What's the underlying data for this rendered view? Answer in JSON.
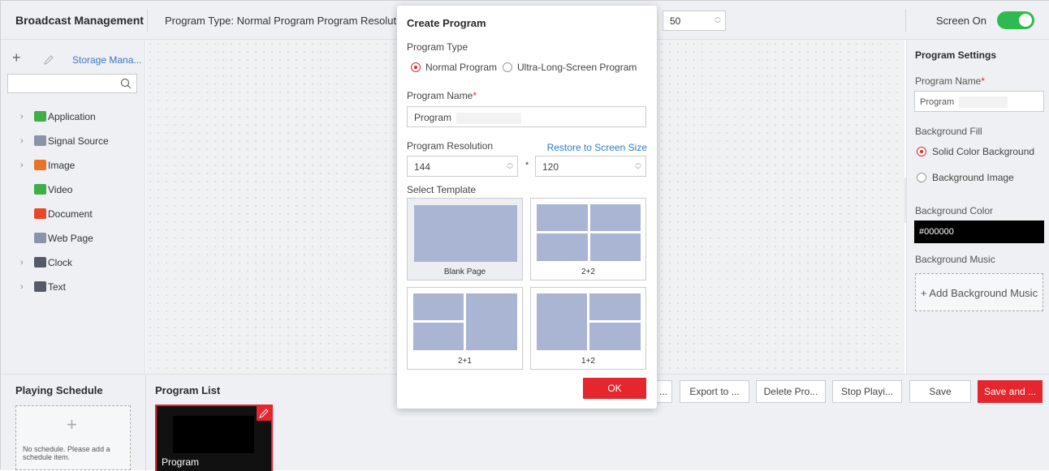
{
  "topbar": {
    "title": "Broadcast Management",
    "info": "Program Type: Normal Program   Program Resolution",
    "zoom_value": "50",
    "screen_label": "Screen On",
    "screen_on": true
  },
  "sidebar": {
    "storage_label": "Storage Mana...",
    "search_value": "",
    "items": [
      {
        "label": "Application",
        "icon": "application-icon",
        "expandable": true,
        "color": "#3fae49"
      },
      {
        "label": "Signal Source",
        "icon": "signal-source-icon",
        "expandable": true,
        "color": "#8a94a6"
      },
      {
        "label": "Image",
        "icon": "image-icon",
        "expandable": true,
        "color": "#e8742a"
      },
      {
        "label": "Video",
        "icon": "video-icon",
        "expandable": false,
        "color": "#3fae49"
      },
      {
        "label": "Document",
        "icon": "pdf-icon",
        "expandable": false,
        "color": "#e8472a"
      },
      {
        "label": "Web Page",
        "icon": "web-page-icon",
        "expandable": false,
        "color": "#8a94a6"
      },
      {
        "label": "Clock",
        "icon": "clock-icon",
        "expandable": true,
        "color": "#555b66"
      },
      {
        "label": "Text",
        "icon": "text-icon",
        "expandable": true,
        "color": "#555b66"
      }
    ]
  },
  "right_panel": {
    "title": "Program Settings",
    "name_label": "Program Name",
    "name_value": "Program",
    "fill_label": "Background Fill",
    "fill_option_solid": "Solid Color Background",
    "fill_option_image": "Background Image",
    "color_label": "Background Color",
    "color_value": "#000000",
    "music_label": "Background Music",
    "music_button": "+ Add Background Music"
  },
  "schedule": {
    "title": "Playing Schedule",
    "empty_note": "No schedule. Please add a schedule item."
  },
  "program_list": {
    "title": "Program List",
    "items": [
      {
        "name": "Program"
      }
    ]
  },
  "actions": {
    "hidden_button": "...",
    "export": "Export to ...",
    "delete": "Delete Pro...",
    "stop": "Stop Playi...",
    "save": "Save",
    "save_and": "Save and ..."
  },
  "dialog": {
    "title": "Create Program",
    "type_label": "Program Type",
    "type_normal": "Normal Program",
    "type_ultra": "Ultra-Long-Screen Program",
    "name_label": "Program Name",
    "name_value": "Program",
    "resolution_label": "Program Resolution",
    "restore_link": "Restore to Screen Size",
    "width": "144",
    "height": "120",
    "times": "*",
    "template_label": "Select Template",
    "templates": [
      {
        "caption": "Blank Page"
      },
      {
        "caption": "2+2"
      },
      {
        "caption": "2+1"
      },
      {
        "caption": "1+2"
      }
    ],
    "ok": "OK"
  },
  "colors": {
    "accent_red": "#e5262e",
    "toggle_green": "#2dbb51",
    "link_blue": "#2b7cd0",
    "template_block": "#a9b5d2"
  }
}
